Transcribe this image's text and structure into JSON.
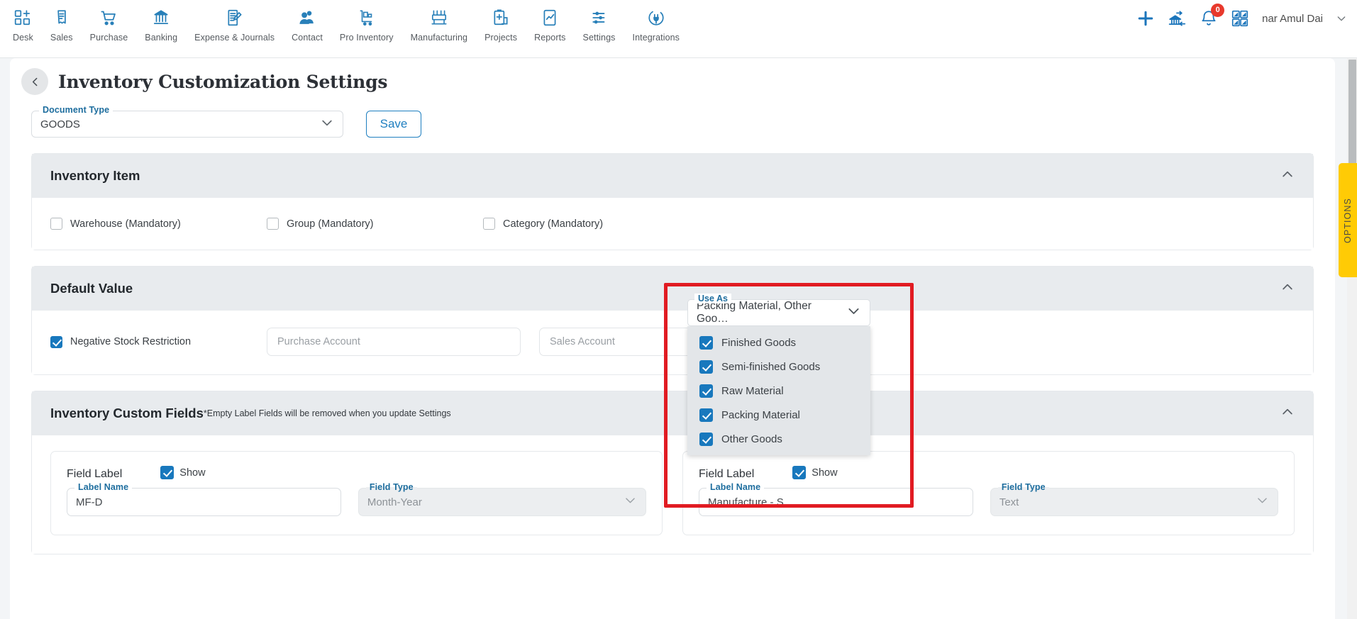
{
  "topnav": {
    "items": [
      {
        "label": "Desk",
        "icon": "desk-icon"
      },
      {
        "label": "Sales",
        "icon": "sales-receipt-icon"
      },
      {
        "label": "Purchase",
        "icon": "purchase-cart-icon"
      },
      {
        "label": "Banking",
        "icon": "bank-icon"
      },
      {
        "label": "Expense & Journals",
        "icon": "journal-pen-icon"
      },
      {
        "label": "Contact",
        "icon": "contact-people-icon"
      },
      {
        "label": "Pro Inventory",
        "icon": "inventory-trolley-icon"
      },
      {
        "label": "Manufacturing",
        "icon": "manufacturing-icon"
      },
      {
        "label": "Projects",
        "icon": "projects-clipboard-icon"
      },
      {
        "label": "Reports",
        "icon": "reports-chart-icon"
      },
      {
        "label": "Settings",
        "icon": "settings-sliders-icon"
      },
      {
        "label": "Integrations",
        "icon": "integrations-plug-icon"
      }
    ],
    "actions": {
      "add": "add-plus-icon",
      "bank_transfer": "bank-transfer-icon",
      "notifications": "bell-icon",
      "notification_count": "0",
      "apps": "apps-grid-icon"
    },
    "user": {
      "name": "nar Amul Dai",
      "caret": "chevron-down-icon"
    }
  },
  "page": {
    "back": "back-chevron-icon",
    "title": "Inventory Customization Settings",
    "document_type": {
      "label": "Document Type",
      "value": "GOODS",
      "caret": "chevron-down-icon"
    },
    "save_label": "Save"
  },
  "inventory_item": {
    "title": "Inventory Item",
    "collapse": "chevron-up-icon",
    "checkboxes": [
      {
        "label": "Warehouse (Mandatory)",
        "checked": false
      },
      {
        "label": "Group (Mandatory)",
        "checked": false
      },
      {
        "label": "Category (Mandatory)",
        "checked": false
      }
    ],
    "use_as": {
      "label": "Use As",
      "value": "Packing Material, Other Goo…",
      "caret": "chevron-down-icon",
      "open": true,
      "options": [
        {
          "label": "Finished Goods",
          "checked": true
        },
        {
          "label": "Semi-finished Goods",
          "checked": true
        },
        {
          "label": "Raw Material",
          "checked": true
        },
        {
          "label": "Packing Material",
          "checked": true
        },
        {
          "label": "Other Goods",
          "checked": true
        }
      ]
    }
  },
  "default_value": {
    "title": "Default Value",
    "collapse": "chevron-up-icon",
    "negative_stock": {
      "label": "Negative Stock Restriction",
      "checked": true
    },
    "purchase_account_placeholder": "Purchase Account",
    "sales_account_placeholder": "Sales Account"
  },
  "custom_fields": {
    "title": "Inventory Custom Fields",
    "note": "*Empty Label Fields will be removed when you update Settings",
    "collapse": "chevron-up-icon",
    "cards": [
      {
        "field_label": "Field Label",
        "show_label": "Show",
        "show_checked": true,
        "label_name_label": "Label Name",
        "label_name_value": "MF-D",
        "field_type_label": "Field Type",
        "field_type_value": "Month-Year",
        "caret": "chevron-down-icon"
      },
      {
        "field_label": "Field Label",
        "show_label": "Show",
        "show_checked": true,
        "label_name_label": "Label Name",
        "label_name_value": "Manufacture - S",
        "field_type_label": "Field Type",
        "field_type_value": "Text",
        "caret": "chevron-down-icon"
      }
    ]
  },
  "options_tab": {
    "label": "OPTIONS"
  },
  "colors": {
    "accent_blue": "#1878bd",
    "nav_icon_blue": "#2980b9",
    "highlight_red": "#e11b22",
    "badge_red": "#e8392c",
    "options_yellow": "#ffcb05",
    "panel_header_grey": "#e8ebee",
    "page_bg": "#f3f5f7"
  }
}
